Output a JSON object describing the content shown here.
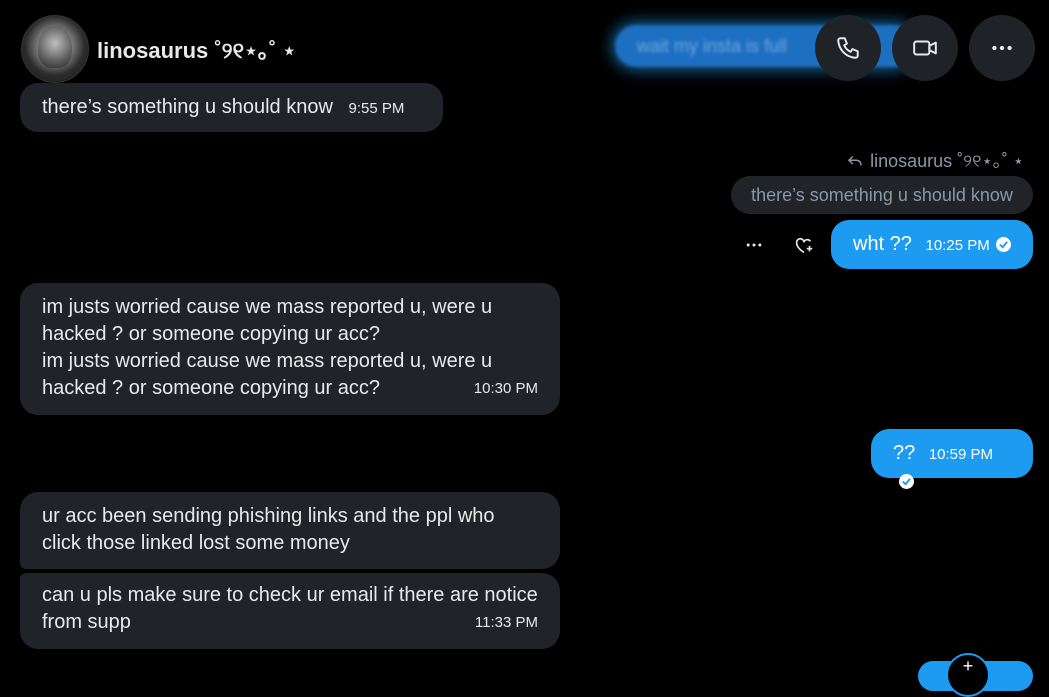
{
  "header": {
    "contact_name": "linosaurus ˚୨୧⋆｡˚ ⋆",
    "glow_preview_text": "wait my insta is full"
  },
  "messages": {
    "m1": {
      "text": "there’s something u should know",
      "time": "9:55 PM"
    },
    "reply": {
      "replying_to": "linosaurus ˚୨୧⋆｡˚ ⋆",
      "quoted_text": "there’s something u should know",
      "text": "wht ??",
      "time": "10:25 PM"
    },
    "m3": {
      "line1": "im justs worried cause we mass reported u, were u hacked ? or someone copying ur acc?",
      "line2": "im justs worried cause we mass reported u, were u hacked ? or someone copying ur acc?",
      "time": "10:30 PM"
    },
    "m4": {
      "text": "??",
      "time": "10:59 PM"
    },
    "m5": {
      "text": "ur acc been sending phishing links  and the ppl who click those linked lost some money"
    },
    "m6": {
      "text": "can u pls  make sure to check ur email if there are notice from supp",
      "time": "11:33 PM"
    }
  },
  "icons": {
    "call": "phone-icon",
    "video": "video-camera-icon",
    "more": "more-horizontal-icon",
    "message_more": "more-horizontal-icon",
    "react": "heart-plus-icon",
    "reply": "reply-arrow-icon",
    "read": "checkmark-circle-icon",
    "new": "plus-icon"
  },
  "colors": {
    "accent": "#1d9bf0",
    "incoming_bubble": "#202327",
    "background": "#000000"
  }
}
